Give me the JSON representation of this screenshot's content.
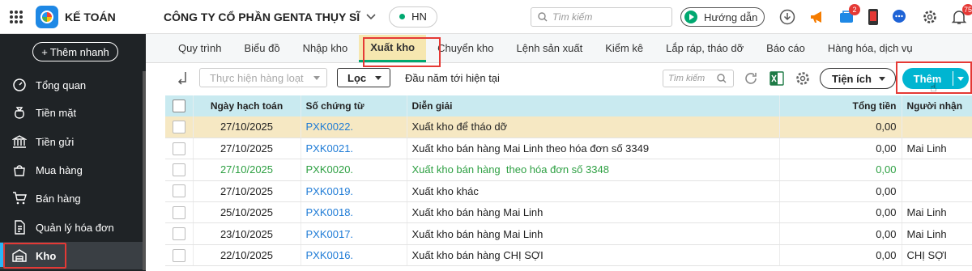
{
  "app": {
    "name": "KẾ TOÁN",
    "company": "CÔNG TY CỔ PHẦN GENTA THỤY SĨ",
    "branch": "HN"
  },
  "topbar": {
    "search_placeholder": "Tìm kiếm",
    "guide_label": "Hướng dẫn",
    "cart_badge": "2",
    "notification_badge": "75"
  },
  "sidebar": {
    "quick_add": "Thêm nhanh",
    "items": [
      {
        "label": "Tổng quan",
        "icon": "dashboard-icon"
      },
      {
        "label": "Tiền mặt",
        "icon": "money-bag-icon"
      },
      {
        "label": "Tiền gửi",
        "icon": "bank-icon"
      },
      {
        "label": "Mua hàng",
        "icon": "shopping-bag-icon"
      },
      {
        "label": "Bán hàng",
        "icon": "cart-icon"
      },
      {
        "label": "Quản lý hóa đơn",
        "icon": "invoice-icon"
      },
      {
        "label": "Kho",
        "icon": "warehouse-icon"
      }
    ]
  },
  "tabs": [
    "Quy trình",
    "Biểu đồ",
    "Nhập kho",
    "Xuất kho",
    "Chuyển kho",
    "Lệnh sản xuất",
    "Kiểm kê",
    "Lắp ráp, tháo dỡ",
    "Báo cáo",
    "Hàng hóa, dịch vụ"
  ],
  "active_tab": "Xuất kho",
  "toolbar": {
    "bulk_label": "Thực hiện hàng loạt",
    "filter_label": "Lọc",
    "period": "Đầu năm tới hiện tại",
    "search_placeholder": "Tìm kiếm",
    "utility_label": "Tiện ích",
    "add_label": "Thêm"
  },
  "table": {
    "columns": [
      "Ngày hạch toán",
      "Số chứng từ",
      "Diễn giải",
      "Tổng tiền",
      "Người nhận"
    ],
    "rows": [
      {
        "date": "27/10/2025",
        "doc": "PXK0022.",
        "desc": "Xuất kho để tháo dỡ",
        "total": "0,00",
        "receiver": ""
      },
      {
        "date": "27/10/2025",
        "doc": "PXK0021.",
        "desc": "Xuất kho bán hàng Mai Linh theo hóa đơn số 3349",
        "total": "0,00",
        "receiver": "Mai Linh"
      },
      {
        "date": "27/10/2025",
        "doc": "PXK0020.",
        "desc": "Xuất kho bán hàng  theo hóa đơn số 3348",
        "total": "0,00",
        "receiver": ""
      },
      {
        "date": "27/10/2025",
        "doc": "PXK0019.",
        "desc": "Xuất kho khác",
        "total": "0,00",
        "receiver": ""
      },
      {
        "date": "25/10/2025",
        "doc": "PXK0018.",
        "desc": "Xuất kho bán hàng Mai Linh",
        "total": "0,00",
        "receiver": "Mai Linh"
      },
      {
        "date": "23/10/2025",
        "doc": "PXK0017.",
        "desc": "Xuất kho bán hàng Mai Linh",
        "total": "0,00",
        "receiver": "Mai Linh"
      },
      {
        "date": "22/10/2025",
        "doc": "PXK0016.",
        "desc": "Xuất kho bán hàng CHỊ SỢI",
        "total": "0,00",
        "receiver": "CHỊ SỢI"
      }
    ]
  }
}
